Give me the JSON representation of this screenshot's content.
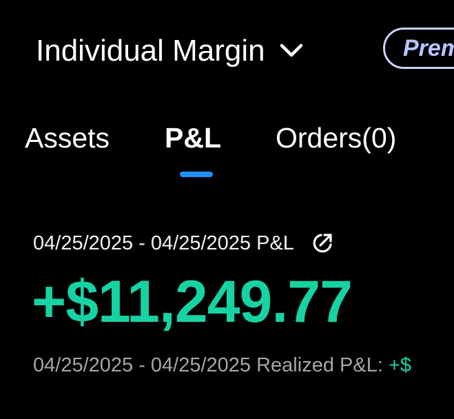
{
  "header": {
    "account_title": "Individual Margin",
    "badge_label": "Premium"
  },
  "tabs": [
    {
      "label": "Assets",
      "active": false
    },
    {
      "label": "P&L",
      "active": true
    },
    {
      "label": "Orders(0)",
      "active": false
    }
  ],
  "pnl": {
    "range_label": "04/25/2025 - 04/25/2025 P&L",
    "total_value": "+$11,249.77",
    "realized_label": "04/25/2025 - 04/25/2025 Realized P&L:",
    "realized_value": "+$"
  },
  "colors": {
    "background": "#000000",
    "positive": "#17d3a4",
    "tab_indicator": "#1e8fff",
    "badge_text": "#b7c3ff"
  },
  "icons": {
    "account_dropdown": "chevron-down-icon",
    "share": "share-icon"
  }
}
